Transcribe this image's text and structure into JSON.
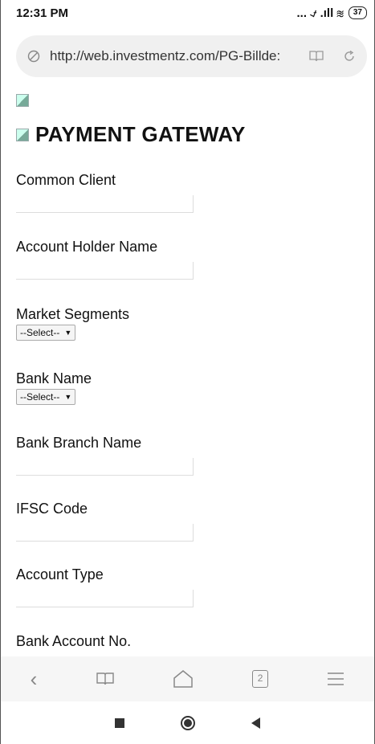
{
  "status": {
    "time": "12:31 PM",
    "battery": "37",
    "signal_icons": "... ⍻ .ıll ≋"
  },
  "browser": {
    "url": "http://web.investmentz.com/PG-Billde:",
    "tab_count": "2"
  },
  "page": {
    "title": "PAYMENT GATEWAY",
    "fields": [
      {
        "label": "Common Client",
        "type": "text"
      },
      {
        "label": "Account Holder Name",
        "type": "text"
      },
      {
        "label": "Market Segments",
        "type": "select",
        "selected": "--Select--"
      },
      {
        "label": "Bank Name",
        "type": "select",
        "selected": "--Select--"
      },
      {
        "label": "Bank Branch Name",
        "type": "text"
      },
      {
        "label": "IFSC Code",
        "type": "text"
      },
      {
        "label": "Account Type",
        "type": "text"
      },
      {
        "label": "Bank Account No.",
        "type": "text"
      }
    ]
  }
}
